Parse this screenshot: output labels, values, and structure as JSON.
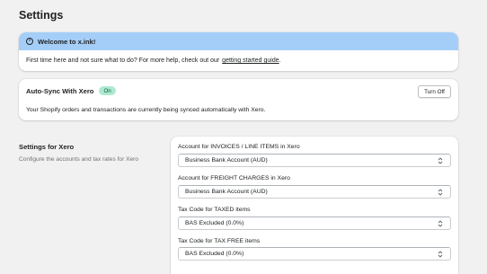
{
  "page": {
    "title": "Settings"
  },
  "banner": {
    "title": "Welcome to x.ink!",
    "body": "First time here and not sure what to do? For more help, check out our",
    "link_text": "getting started guide",
    "link_suffix": "."
  },
  "sync": {
    "title": "Auto-Sync With Xero",
    "badge": "On",
    "button": "Turn Off",
    "description": "Your Shopify orders and transactions are currently being synced automatically with Xero."
  },
  "xero": {
    "title": "Settings for Xero",
    "description": "Configure the accounts and tax rates for Xero",
    "fields": [
      {
        "label": "Account for INVOICES / LINE ITEMS in Xero",
        "value": "Business Bank Account (AUD)"
      },
      {
        "label": "Account for FREIGHT CHARGES in Xero",
        "value": "Business Bank Account (AUD)"
      },
      {
        "label": "Tax Code for TAXED items",
        "value": "BAS Excluded (0.0%)"
      },
      {
        "label": "Tax Code for TAX FREE items",
        "value": "BAS Excluded (0.0%)"
      }
    ]
  },
  "colors": {
    "banner_bg": "#a4cef8",
    "badge_bg": "#aee9d1",
    "page_bg": "#f1f1f1"
  },
  "icons": {
    "info": "info-icon",
    "select": "chevron-up-down-icon"
  }
}
